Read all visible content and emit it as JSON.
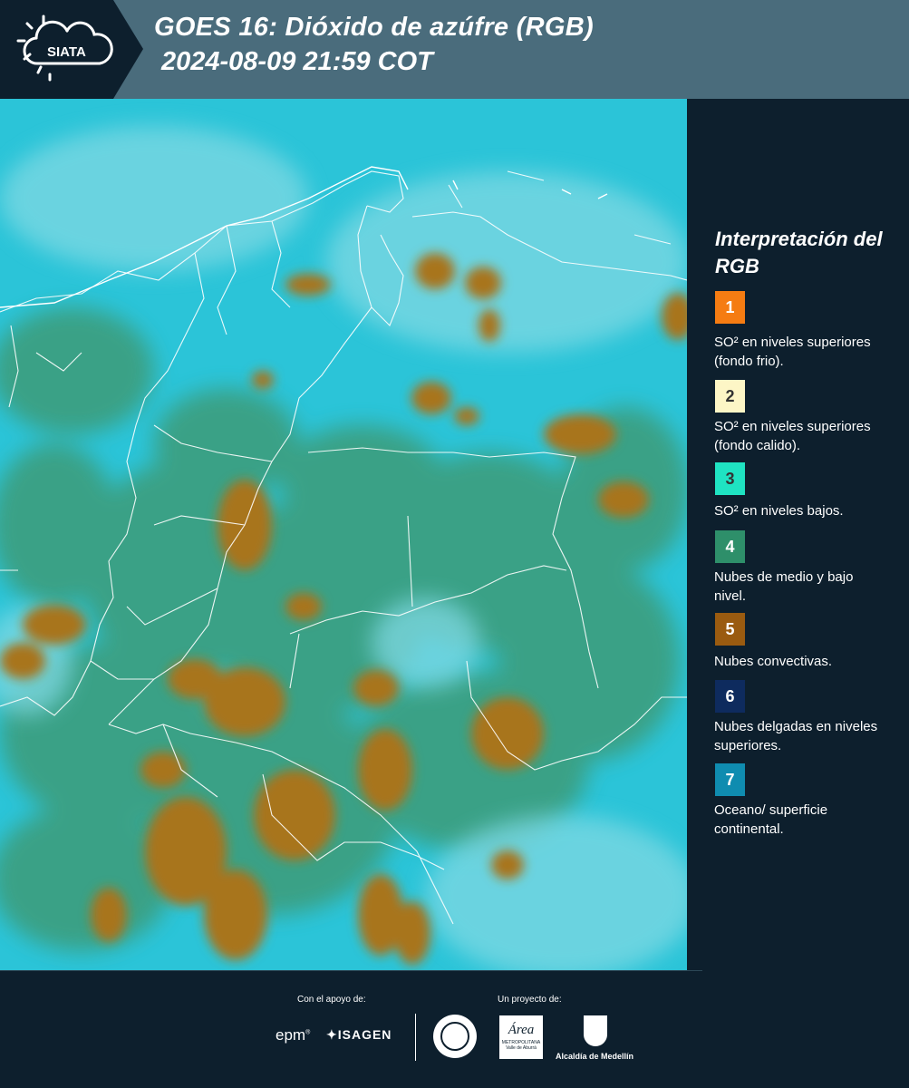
{
  "header": {
    "logo_text": "SIATA",
    "title_line1": "GOES 16: Dióxido de azúfre (RGB)",
    "title_line2": " 2024-08-09 21:59 COT"
  },
  "legend": {
    "title": "Interpretación del RGB",
    "items": [
      {
        "number": "1",
        "color": "#f57c12",
        "text": "SO² en niveles superiores (fondo frio)."
      },
      {
        "number": "2",
        "color": "#fdf6c6",
        "text": "SO² en niveles superiores (fondo calido)."
      },
      {
        "number": "3",
        "color": "#1fe3c2",
        "text": "SO² en niveles bajos."
      },
      {
        "number": "4",
        "color": "#2e8f6a",
        "text": "Nubes de medio y bajo nivel."
      },
      {
        "number": "5",
        "color": "#9a5b10",
        "text": "Nubes convectivas."
      },
      {
        "number": "6",
        "color": "#0e2b5e",
        "text": "Nubes delgadas en niveles superiores."
      },
      {
        "number": "7",
        "color": "#0f8cb0",
        "text": "Oceano/ superficie continental."
      }
    ]
  },
  "footer": {
    "support_label": "Con el apoyo de:",
    "project_label": "Un proyecto de:",
    "sponsors": [
      "epm",
      "ISAGEN"
    ],
    "partner_logo_texts": [
      "Área",
      "METROPOLITANA",
      "Valle de Aburrá",
      "Alcaldía de Medellín"
    ]
  },
  "colors": {
    "header_bg": "#4a6c7c",
    "panel_bg": "#0d1f2d",
    "map_ocean": "#2bc4d8",
    "map_low_cloud": "#2e8f6a",
    "map_convective": "#a8741e"
  }
}
